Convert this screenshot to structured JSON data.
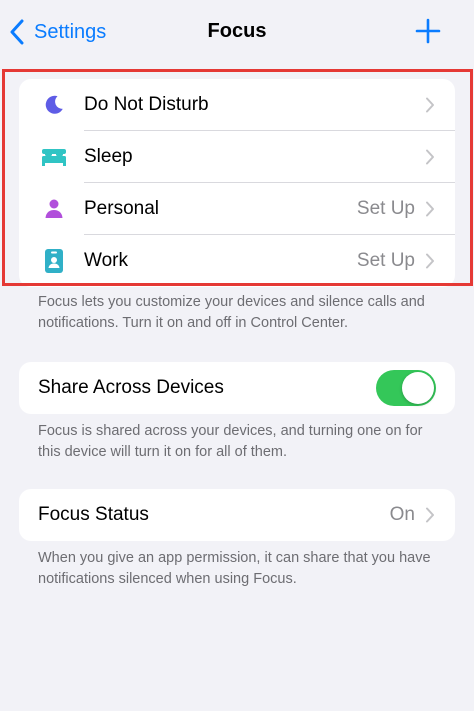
{
  "nav": {
    "back_label": "Settings",
    "title": "Focus"
  },
  "modes": [
    {
      "label": "Do Not Disturb",
      "value": "",
      "icon": "moon-icon"
    },
    {
      "label": "Sleep",
      "value": "",
      "icon": "bed-icon"
    },
    {
      "label": "Personal",
      "value": "Set Up",
      "icon": "person-icon"
    },
    {
      "label": "Work",
      "value": "Set Up",
      "icon": "badge-icon"
    }
  ],
  "modes_footnote": "Focus lets you customize your devices and silence calls and notifications. Turn it on and off in Control Center.",
  "share": {
    "label": "Share Across Devices",
    "enabled": true
  },
  "share_footnote": "Focus is shared across your devices, and turning one on for this device will turn it on for all of them.",
  "status": {
    "label": "Focus Status",
    "value": "On"
  },
  "status_footnote": "When you give an app permission, it can share that you have notifications silenced when using Focus.",
  "colors": {
    "accent": "#0a7cff",
    "moon": "#5e5ce6",
    "sleep": "#30c4c4",
    "personal": "#b14fdb",
    "work": "#30b0c7",
    "toggle_on": "#34c759",
    "highlight": "#e53935"
  }
}
